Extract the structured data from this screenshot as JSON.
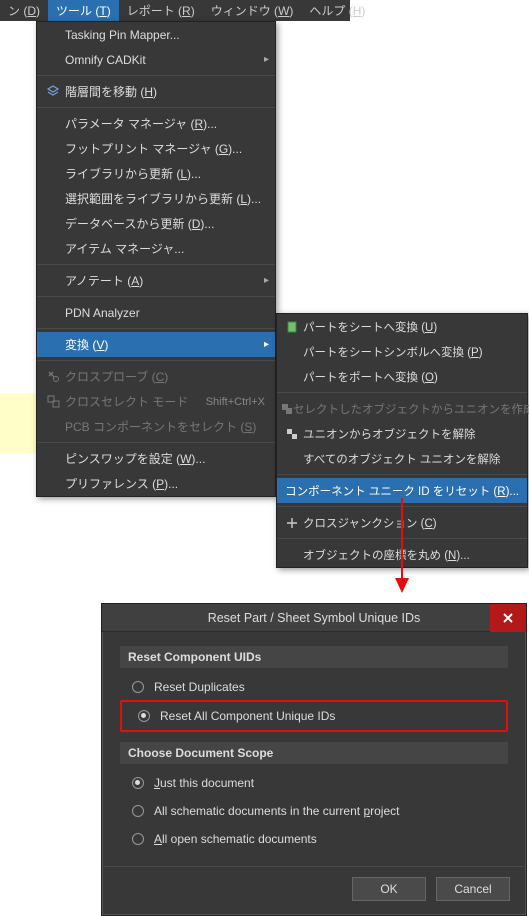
{
  "menubar": {
    "items": [
      {
        "prefix": "ン (",
        "key": "D",
        "suffix": ")"
      },
      {
        "prefix": "ツール (",
        "key": "T",
        "suffix": ")"
      },
      {
        "prefix": "レポート (",
        "key": "R",
        "suffix": ")"
      },
      {
        "prefix": "ウィンドウ (",
        "key": "W",
        "suffix": ")"
      },
      {
        "prefix": "ヘルプ (",
        "key": "H",
        "suffix": ")"
      }
    ],
    "active_index": 1
  },
  "menu1": [
    {
      "label": "Tasking Pin Mapper..."
    },
    {
      "label_prefix": "Omnify CADKit",
      "hassub": true
    },
    {
      "divider": true
    },
    {
      "icon": "layers",
      "label_prefix": "階層間を移動 (",
      "key": "H",
      "label_suffix": ")"
    },
    {
      "divider": true
    },
    {
      "label_prefix": "パラメータ マネージャ (",
      "key": "R",
      "label_suffix": ")..."
    },
    {
      "label_prefix": "フットプリント マネージャ (",
      "key": "G",
      "label_suffix": ")..."
    },
    {
      "label_prefix": "ライブラリから更新 (",
      "key": "L",
      "label_suffix": ")..."
    },
    {
      "label_prefix": "選択範囲をライブラリから更新 (",
      "key": "L",
      "label_suffix": ")..."
    },
    {
      "label_prefix": "データベースから更新 (",
      "key": "D",
      "label_suffix": ")..."
    },
    {
      "label_prefix": "アイテム マネージャ..."
    },
    {
      "divider": true
    },
    {
      "label_prefix": "アノテート (",
      "key": "A",
      "label_suffix": ")",
      "hassub": true
    },
    {
      "divider": true
    },
    {
      "label_prefix": "PDN Analyzer"
    },
    {
      "divider": true
    },
    {
      "label_prefix": "変換 (",
      "key": "V",
      "label_suffix": ")",
      "hassub": true,
      "highlight": true
    },
    {
      "divider": true
    },
    {
      "icon": "crossprobe",
      "label_prefix": "クロスプローブ (",
      "key": "C",
      "label_suffix": ")",
      "disabled": true
    },
    {
      "icon": "crosssel",
      "label_prefix": "クロスセレクト モード",
      "shortcut": "Shift+Ctrl+X",
      "disabled": true
    },
    {
      "label_prefix": "PCB コンポーネントをセレクト (",
      "key": "S",
      "label_suffix": ")",
      "disabled": true
    },
    {
      "divider": true
    },
    {
      "label_prefix": "ピンスワップを設定 (",
      "key": "W",
      "label_suffix": ")..."
    },
    {
      "label_prefix": "プリファレンス (",
      "key": "P",
      "label_suffix": ")..."
    }
  ],
  "menu2": [
    {
      "icon": "sheet",
      "label_prefix": "パートをシートへ変換 (",
      "key": "U",
      "label_suffix": ")"
    },
    {
      "label_prefix": "パートをシートシンボルへ変換 (",
      "key": "P",
      "label_suffix": ")"
    },
    {
      "label_prefix": "パートをポートへ変換 (",
      "key": "O",
      "label_suffix": ")"
    },
    {
      "divider": true
    },
    {
      "icon": "union",
      "label_prefix": "セレクトしたオブジェクトからユニオンを作成",
      "disabled": true
    },
    {
      "icon": "ununion",
      "label_prefix": "ユニオンからオブジェクトを解除"
    },
    {
      "label_prefix": "すべてのオブジェクト ユニオンを解除"
    },
    {
      "divider": true
    },
    {
      "label_prefix": "コンポーネント ユニーク ID をリセット (",
      "key": "R",
      "label_suffix": ")...",
      "highlight": true
    },
    {
      "divider": true
    },
    {
      "icon": "cross",
      "label_prefix": "クロスジャンクション (",
      "key": "C",
      "label_suffix": ")"
    },
    {
      "divider": true
    },
    {
      "label_prefix": "オブジェクトの座標を丸め (",
      "key": "N",
      "label_suffix": ")..."
    }
  ],
  "dialog": {
    "title": "Reset Part / Sheet Symbol Unique IDs",
    "group1": {
      "header": "Reset Component UIDs",
      "opt1": {
        "label": "Reset Duplicates",
        "checked": false
      },
      "opt2": {
        "label": "Reset All Component Unique IDs",
        "checked": true
      }
    },
    "group2": {
      "header": "Choose Document Scope",
      "opt1": {
        "prefix": "",
        "key": "J",
        "mid": "ust this document",
        "checked": true
      },
      "opt2": {
        "prefix": "All schematic documents in the current ",
        "key": "p",
        "mid": "roject",
        "checked": false
      },
      "opt3": {
        "prefix": "",
        "key": "A",
        "mid": "ll open schematic documents",
        "checked": false
      }
    },
    "buttons": {
      "ok": "OK",
      "cancel": "Cancel"
    }
  }
}
